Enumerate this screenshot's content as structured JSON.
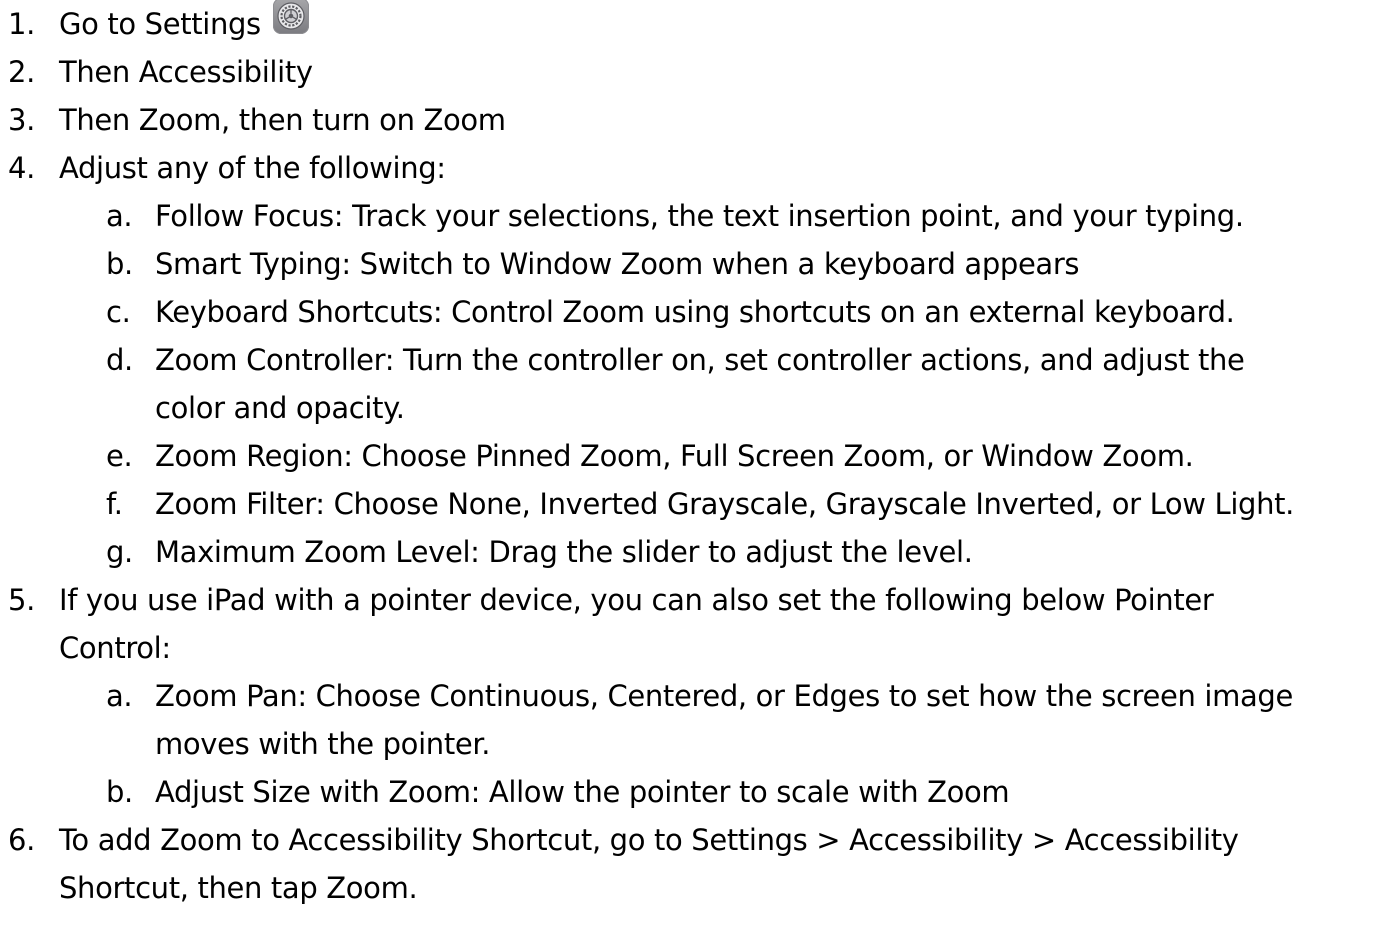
{
  "steps": [
    {
      "num": "1.",
      "text": "Go to Settings",
      "icon": "settings-gear-icon"
    },
    {
      "num": "2.",
      "text": "Then Accessibility"
    },
    {
      "num": "3.",
      "text": "Then Zoom, then turn on Zoom"
    },
    {
      "num": "4.",
      "text": "Adjust any of the following:"
    },
    {
      "num": "5.",
      "text": "If you use iPad with a pointer device, you can also set the following below Pointer",
      "text2": "Control:"
    },
    {
      "num": "6.",
      "text": "To add Zoom to Accessibility Shortcut, go to Settings > Accessibility > Accessibility",
      "text2": "Shortcut, then tap Zoom."
    }
  ],
  "step4_items": [
    {
      "letter": "a.",
      "text": "Follow Focus: Track your selections, the text insertion point, and your typing."
    },
    {
      "letter": "b.",
      "text": "Smart Typing: Switch to Window Zoom when a keyboard appears"
    },
    {
      "letter": "c.",
      "text": "Keyboard Shortcuts: Control Zoom using shortcuts on an external keyboard."
    },
    {
      "letter": "d.",
      "text": "Zoom Controller: Turn the controller on, set controller actions, and adjust the",
      "text2": "color and opacity."
    },
    {
      "letter": "e.",
      "text": "Zoom Region: Choose Pinned Zoom, Full Screen Zoom, or Window Zoom."
    },
    {
      "letter": "f.",
      "text": "Zoom Filter: Choose None, Inverted Grayscale, Grayscale Inverted, or Low Light."
    },
    {
      "letter": "g.",
      "text": "Maximum Zoom Level: Drag the slider to adjust the level."
    }
  ],
  "step5_items": [
    {
      "letter": "a.",
      "text": "Zoom Pan: Choose Continuous, Centered, or Edges to set how the screen image",
      "text2": "moves with the pointer."
    },
    {
      "letter": "b.",
      "text": "Adjust Size with Zoom: Allow the pointer to scale with Zoom"
    }
  ]
}
